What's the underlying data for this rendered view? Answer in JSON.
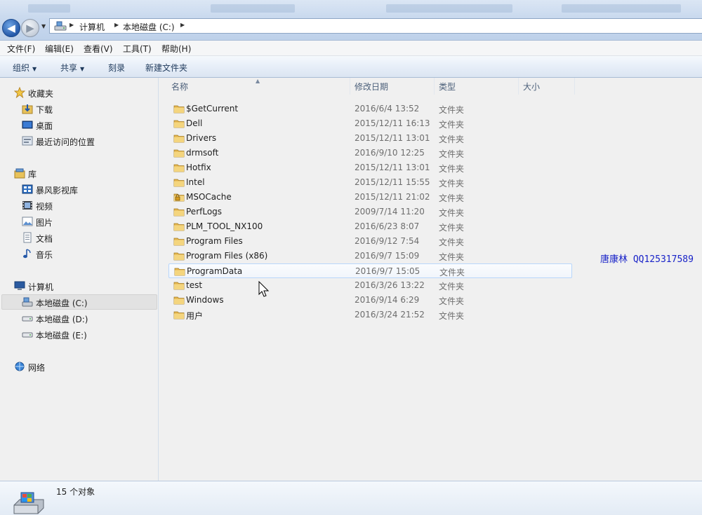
{
  "address": {
    "crumbs": [
      "计算机",
      "本地磁盘 (C:)"
    ]
  },
  "menu": [
    "文件(F)",
    "编辑(E)",
    "查看(V)",
    "工具(T)",
    "帮助(H)"
  ],
  "commands": [
    "组织",
    "共享",
    "刻录",
    "新建文件夹"
  ],
  "nav": {
    "favorites": {
      "label": "收藏夹",
      "items": [
        "下载",
        "桌面",
        "最近访问的位置"
      ]
    },
    "libraries": {
      "label": "库",
      "items": [
        "暴风影视库",
        "视频",
        "图片",
        "文档",
        "音乐"
      ]
    },
    "computer": {
      "label": "计算机",
      "items": [
        "本地磁盘 (C:)",
        "本地磁盘 (D:)",
        "本地磁盘 (E:)"
      ]
    },
    "network": {
      "label": "网络"
    }
  },
  "columns": [
    "名称",
    "修改日期",
    "类型",
    "大小"
  ],
  "files": [
    {
      "name": "$GetCurrent",
      "date": "2016/6/4 13:52",
      "type": "文件夹"
    },
    {
      "name": "Dell",
      "date": "2015/12/11 16:13",
      "type": "文件夹"
    },
    {
      "name": "Drivers",
      "date": "2015/12/11 13:01",
      "type": "文件夹"
    },
    {
      "name": "drmsoft",
      "date": "2016/9/10 12:25",
      "type": "文件夹"
    },
    {
      "name": "Hotfix",
      "date": "2015/12/11 13:01",
      "type": "文件夹"
    },
    {
      "name": "Intel",
      "date": "2015/12/11 15:55",
      "type": "文件夹"
    },
    {
      "name": "MSOCache",
      "date": "2015/12/11 21:02",
      "type": "文件夹"
    },
    {
      "name": "PerfLogs",
      "date": "2009/7/14 11:20",
      "type": "文件夹"
    },
    {
      "name": "PLM_TOOL_NX100",
      "date": "2016/6/23 8:07",
      "type": "文件夹"
    },
    {
      "name": "Program Files",
      "date": "2016/9/12 7:54",
      "type": "文件夹"
    },
    {
      "name": "Program Files (x86)",
      "date": "2016/9/7 15:09",
      "type": "文件夹"
    },
    {
      "name": "ProgramData",
      "date": "2016/9/7 15:05",
      "type": "文件夹"
    },
    {
      "name": "test",
      "date": "2016/3/26 13:22",
      "type": "文件夹"
    },
    {
      "name": "Windows",
      "date": "2016/9/14 6:29",
      "type": "文件夹"
    },
    {
      "name": "用户",
      "date": "2016/3/24 21:52",
      "type": "文件夹"
    }
  ],
  "watermark": "唐康林 QQ125317589",
  "status": {
    "count": "15 个对象"
  },
  "colors": {
    "accent": "#2458a8",
    "watermark": "#1822c8",
    "folder": "#e8c25a"
  }
}
